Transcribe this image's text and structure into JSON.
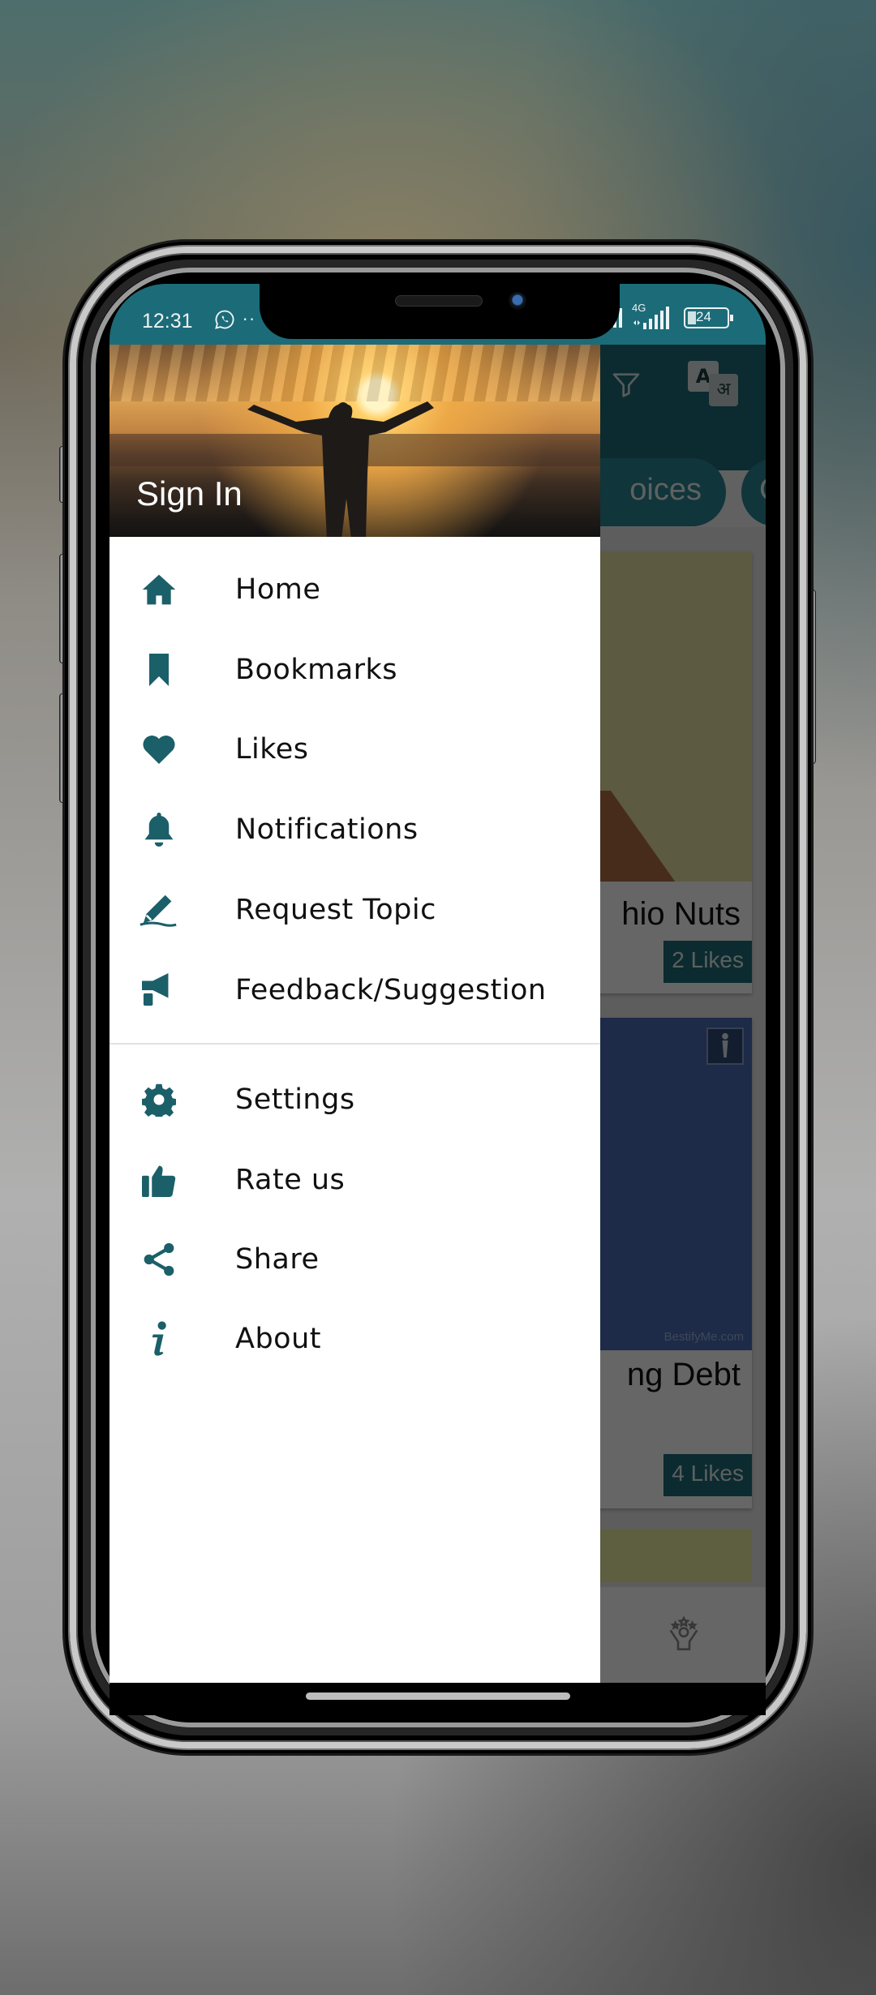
{
  "status_bar": {
    "time": "12:31",
    "left_icons": [
      "whatsapp-icon",
      "more-dots-icon"
    ],
    "network_label": "4G",
    "battery_level": "24",
    "right_icons": [
      "signal-icon",
      "4g-signal-icon",
      "battery-icon"
    ]
  },
  "drawer": {
    "header": {
      "sign_in_label": "Sign In",
      "image_description": "silhouette-with-open-arms-at-sunset"
    },
    "primary_items": [
      {
        "label": "Home",
        "icon": "home-icon"
      },
      {
        "label": "Bookmarks",
        "icon": "bookmark-icon"
      },
      {
        "label": "Likes",
        "icon": "heart-icon"
      },
      {
        "label": "Notifications",
        "icon": "bell-icon"
      },
      {
        "label": "Request Topic",
        "icon": "pencil-icon"
      },
      {
        "label": "Feedback/Suggestion",
        "icon": "megaphone-icon"
      }
    ],
    "secondary_items": [
      {
        "label": "Settings",
        "icon": "gear-icon"
      },
      {
        "label": "Rate us",
        "icon": "thumbs-up-icon"
      },
      {
        "label": "Share",
        "icon": "share-icon"
      },
      {
        "label": "About",
        "icon": "info-icon"
      }
    ]
  },
  "background_app": {
    "toolbar_icons": [
      "filter-icon",
      "translate-icon"
    ],
    "translate_icon_text": [
      "A",
      "अ"
    ],
    "chips": [
      "oices",
      "C"
    ],
    "cards": [
      {
        "title_fragment": "hio Nuts",
        "likes": "2 Likes"
      },
      {
        "title_fragment": "ng Debt",
        "likes": "4 Likes",
        "watermark": "BestifyMe.com"
      }
    ],
    "bottom_nav_icons": [
      "achievement-icon"
    ]
  },
  "colors": {
    "accent": "#1c6b78",
    "icon_teal": "#1b5f69",
    "drawer_bg": "#ffffff",
    "text": "#111111"
  }
}
